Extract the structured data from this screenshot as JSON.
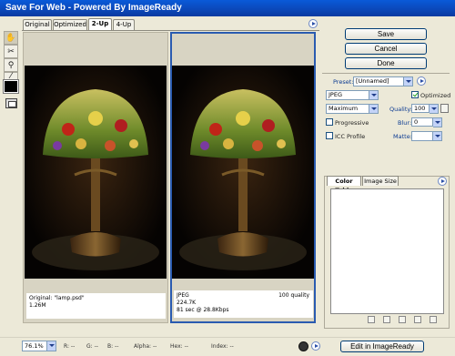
{
  "window": {
    "title": "Save For Web - Powered By ImageReady"
  },
  "tabs": [
    {
      "label": "Original"
    },
    {
      "label": "Optimized"
    },
    {
      "label": "2-Up"
    },
    {
      "label": "4-Up"
    }
  ],
  "active_tab": "2-Up",
  "tools": [
    "hand-icon",
    "slice-select-icon",
    "zoom-icon",
    "eyedropper-icon"
  ],
  "panes": {
    "left": {
      "line1": "Original: \"lamp.psd\"",
      "line2": "1.26M"
    },
    "right": {
      "line1": "JPEG",
      "line2": "224.7K",
      "line3": "81 sec @ 28.8Kbps",
      "quality_note": "100 quality"
    }
  },
  "buttons": {
    "save": "Save",
    "cancel": "Cancel",
    "done": "Done",
    "edit": "Edit in ImageReady"
  },
  "settings": {
    "preset_label": "Preset:",
    "preset_value": "[Unnamed]",
    "format": "JPEG",
    "quality_level": "Maximum",
    "optimized_label": "Optimized",
    "optimized_checked": true,
    "quality_label": "Quality:",
    "quality_value": "100",
    "progressive_label": "Progressive",
    "progressive_checked": false,
    "blur_label": "Blur:",
    "blur_value": "0",
    "icc_label": "ICC Profile",
    "icc_checked": false,
    "matte_label": "Matte:"
  },
  "panel_tabs": {
    "color_table": "Color Table",
    "image_size": "Image Size"
  },
  "status": {
    "zoom": "76.1%",
    "r": "R: --",
    "g": "G: --",
    "b": "B: --",
    "alpha": "Alpha: --",
    "hex": "Hex: --",
    "index": "Index: --"
  },
  "colors": {
    "title_bar": "#0b47b8",
    "accent_border": "#2a5bb0",
    "background": "#ece9d8"
  }
}
